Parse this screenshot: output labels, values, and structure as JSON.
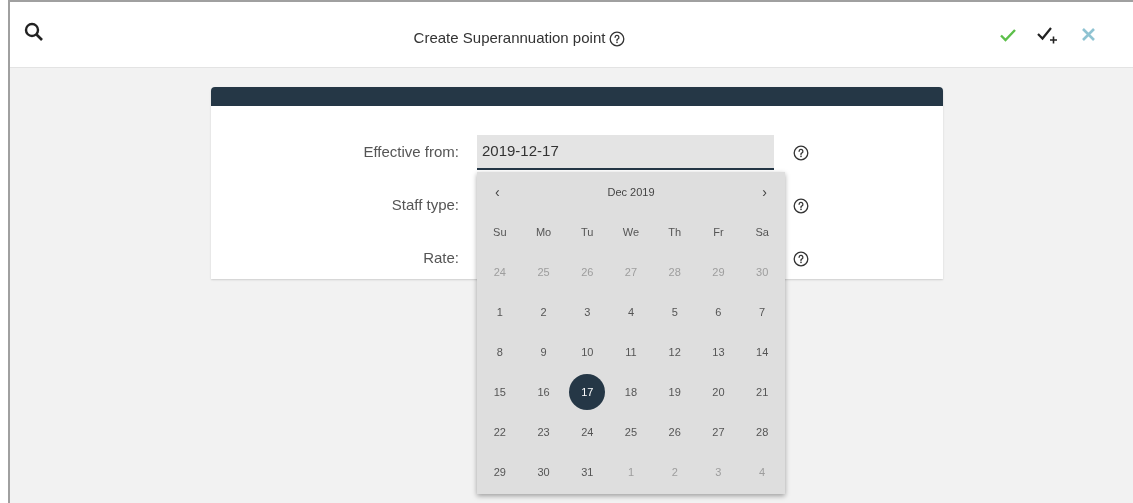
{
  "toolbar": {
    "title": "Create Superannuation point",
    "actions": [
      {
        "kind": "save"
      },
      {
        "kind": "save-new"
      },
      {
        "kind": "cancel"
      }
    ]
  },
  "form": {
    "fields": [
      {
        "label": "Effective from:",
        "value": "2019-12-17"
      },
      {
        "label": "Staff type:"
      },
      {
        "label": "Rate:"
      }
    ]
  },
  "datepicker": {
    "prev": "‹",
    "month": "Dec 2019",
    "next": "›",
    "weekdays": [
      "Su",
      "Mo",
      "Tu",
      "We",
      "Th",
      "Fr",
      "Sa"
    ],
    "weeks": [
      [
        {
          "day": "24",
          "muted": true,
          "selected": false
        },
        {
          "day": "25",
          "muted": true,
          "selected": false
        },
        {
          "day": "26",
          "muted": true,
          "selected": false
        },
        {
          "day": "27",
          "muted": true,
          "selected": false
        },
        {
          "day": "28",
          "muted": true,
          "selected": false
        },
        {
          "day": "29",
          "muted": true,
          "selected": false
        },
        {
          "day": "30",
          "muted": true,
          "selected": false
        }
      ],
      [
        {
          "day": "1",
          "muted": false,
          "selected": false
        },
        {
          "day": "2",
          "muted": false,
          "selected": false
        },
        {
          "day": "3",
          "muted": false,
          "selected": false
        },
        {
          "day": "4",
          "muted": false,
          "selected": false
        },
        {
          "day": "5",
          "muted": false,
          "selected": false
        },
        {
          "day": "6",
          "muted": false,
          "selected": false
        },
        {
          "day": "7",
          "muted": false,
          "selected": false
        }
      ],
      [
        {
          "day": "8",
          "muted": false,
          "selected": false
        },
        {
          "day": "9",
          "muted": false,
          "selected": false
        },
        {
          "day": "10",
          "muted": false,
          "selected": false
        },
        {
          "day": "11",
          "muted": false,
          "selected": false
        },
        {
          "day": "12",
          "muted": false,
          "selected": false
        },
        {
          "day": "13",
          "muted": false,
          "selected": false
        },
        {
          "day": "14",
          "muted": false,
          "selected": false
        }
      ],
      [
        {
          "day": "15",
          "muted": false,
          "selected": false
        },
        {
          "day": "16",
          "muted": false,
          "selected": false
        },
        {
          "day": "17",
          "muted": false,
          "selected": true
        },
        {
          "day": "18",
          "muted": false,
          "selected": false
        },
        {
          "day": "19",
          "muted": false,
          "selected": false
        },
        {
          "day": "20",
          "muted": false,
          "selected": false
        },
        {
          "day": "21",
          "muted": false,
          "selected": false
        }
      ],
      [
        {
          "day": "22",
          "muted": false,
          "selected": false
        },
        {
          "day": "23",
          "muted": false,
          "selected": false
        },
        {
          "day": "24",
          "muted": false,
          "selected": false
        },
        {
          "day": "25",
          "muted": false,
          "selected": false
        },
        {
          "day": "26",
          "muted": false,
          "selected": false
        },
        {
          "day": "27",
          "muted": false,
          "selected": false
        },
        {
          "day": "28",
          "muted": false,
          "selected": false
        }
      ],
      [
        {
          "day": "29",
          "muted": false,
          "selected": false
        },
        {
          "day": "30",
          "muted": false,
          "selected": false
        },
        {
          "day": "31",
          "muted": false,
          "selected": false
        },
        {
          "day": "1",
          "muted": true,
          "selected": false
        },
        {
          "day": "2",
          "muted": true,
          "selected": false
        },
        {
          "day": "3",
          "muted": true,
          "selected": false
        },
        {
          "day": "4",
          "muted": true,
          "selected": false
        }
      ]
    ]
  }
}
